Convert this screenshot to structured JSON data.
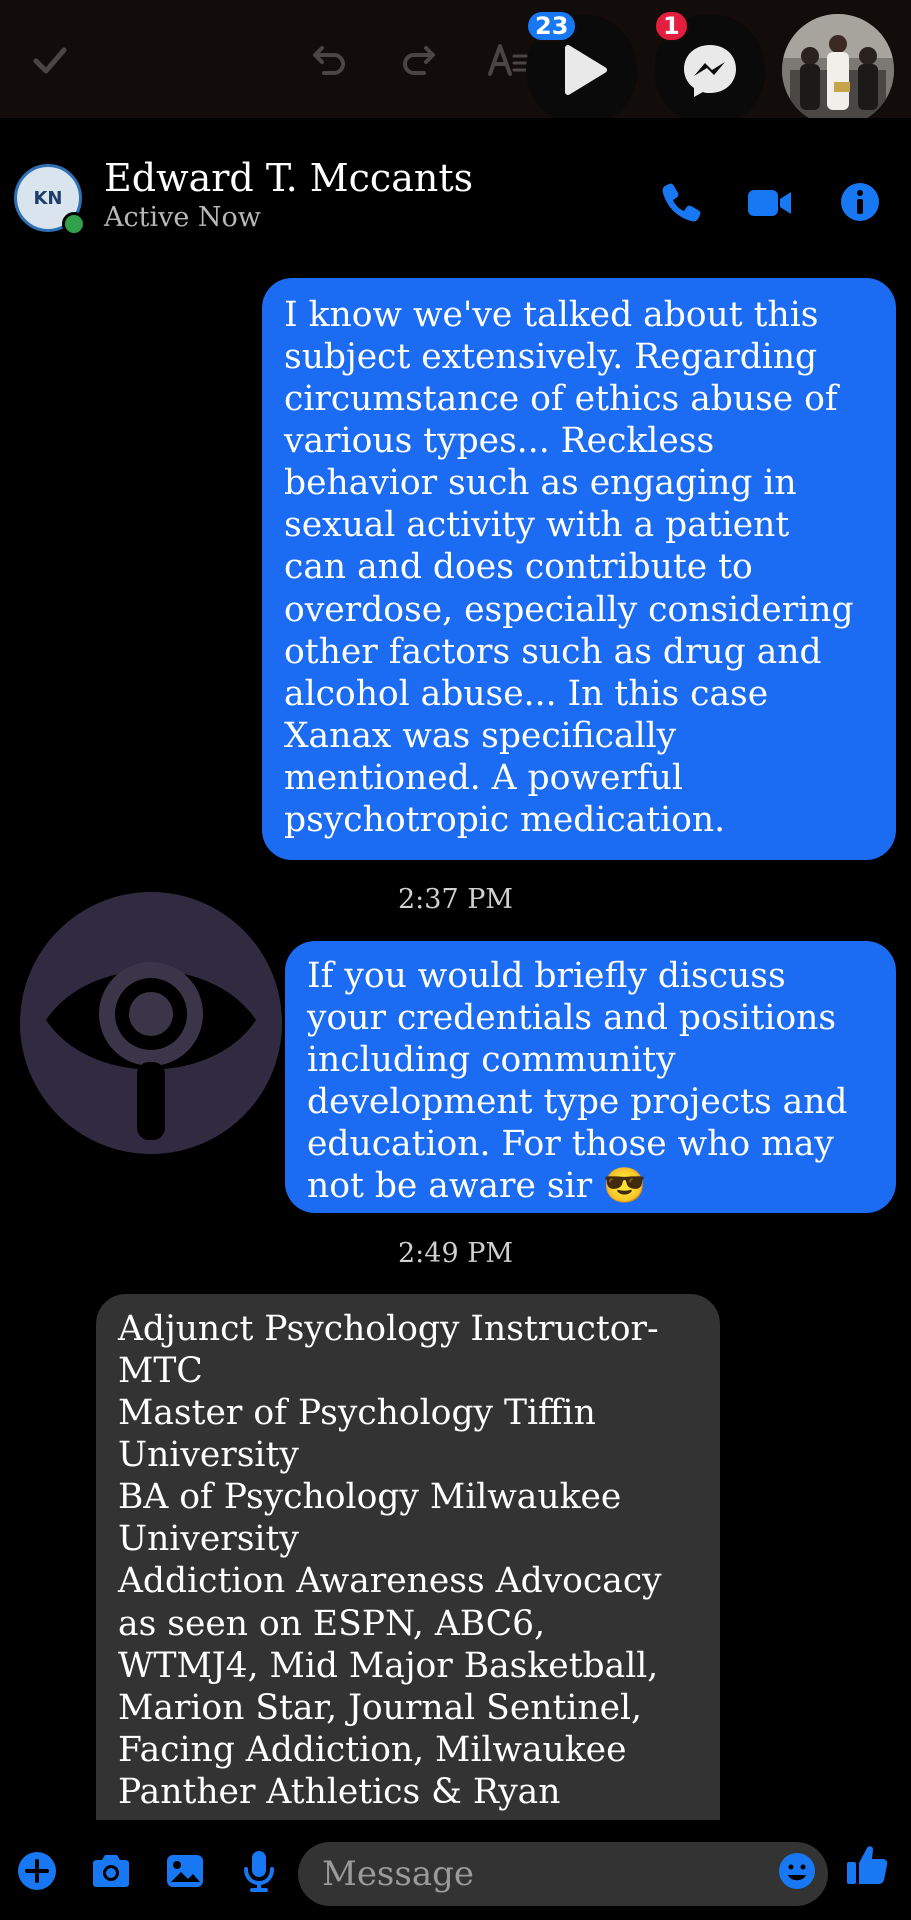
{
  "toolbar": {
    "icons": [
      "checkmark-icon",
      "undo-icon",
      "redo-icon",
      "text-format-icon"
    ],
    "chat_heads": [
      {
        "name": "video-chat-head",
        "badge": "23",
        "badge_color": "#1877f2"
      },
      {
        "name": "messenger-chat-head",
        "badge": "1",
        "badge_color": "#e41e3f"
      },
      {
        "name": "photo-chat-head"
      }
    ]
  },
  "header": {
    "contact_name": "Edward T. Mccants",
    "status": "Active Now",
    "avatar_initials": "KN",
    "accent_color": "#1877f2",
    "actions": [
      "phone-icon",
      "video-camera-icon",
      "info-icon"
    ]
  },
  "messages": [
    {
      "direction": "sent",
      "lines": [
        "I know we've talked about this",
        "subject extensively. Regarding",
        "circumstance of ethics abuse of",
        "various types... Reckless",
        "behavior such as engaging in",
        "sexual activity with a patient",
        "can and does contribute to",
        "overdose, especially considering",
        "other factors such as drug and",
        "alcohol abuse... In this case",
        "Xanax was specifically",
        "mentioned. A powerful",
        "psychotropic medication."
      ]
    },
    {
      "timestamp": "2:37 PM"
    },
    {
      "direction": "sent",
      "lines": [
        "If you would briefly discuss",
        "your credentials and positions",
        "including community",
        "development type projects and",
        "education. For those who may",
        "not be aware sir 😎"
      ]
    },
    {
      "timestamp": "2:49 PM"
    },
    {
      "direction": "received",
      "lines": [
        "Adjunct Psychology Instructor-",
        "MTC",
        "Master of Psychology Tiffin",
        "University",
        "BA of Psychology Milwaukee",
        "University",
        "Addiction Awareness Advocacy",
        "as seen on ESPN, ABC6,",
        "WTMJ4, Mid Major Basketball,",
        "Marion Star, Journal Sentinel,",
        "Facing Addiction, Milwaukee",
        "Panther Athletics & Ryan"
      ]
    }
  ],
  "composer": {
    "placeholder": "Message",
    "left_icons": [
      "plus-icon",
      "camera-icon",
      "image-icon",
      "microphone-icon"
    ],
    "emoji_icon": "emoji-icon",
    "like_icon": "thumbs-up-icon"
  }
}
